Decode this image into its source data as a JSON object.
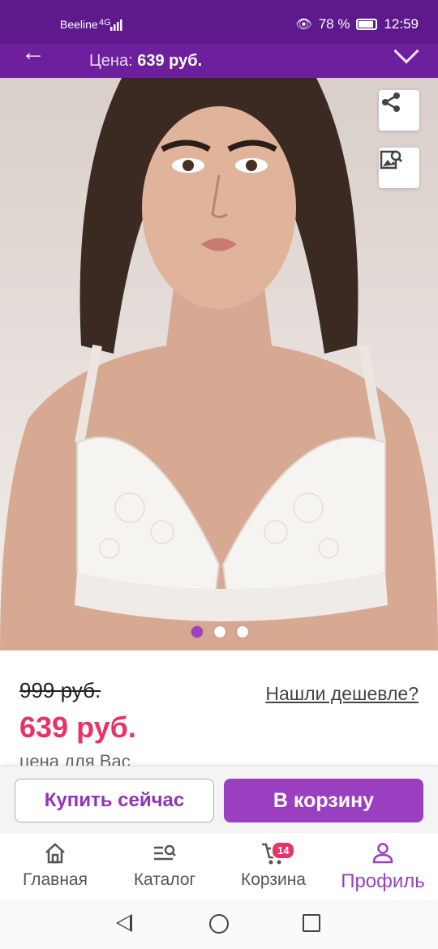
{
  "status_bar": {
    "carrier": "Beeline",
    "network": "4G",
    "battery": "78 %",
    "time": "12:59"
  },
  "header": {
    "price_label": "Цена:",
    "price_value": "639 руб."
  },
  "gallery": {
    "image_alt": "woman wearing white lace push-up bra",
    "dots": [
      true,
      false,
      false
    ]
  },
  "price": {
    "old": "999 руб.",
    "new": "639 руб.",
    "note": "цена для Вас",
    "cheaper_link": "Нашли дешевле?"
  },
  "actions": {
    "buy_now": "Купить сейчас",
    "add_to_cart": "В корзину"
  },
  "nav": {
    "items": [
      {
        "label": "Главная",
        "icon": "home-icon"
      },
      {
        "label": "Каталог",
        "icon": "catalog-search-icon"
      },
      {
        "label": "Корзина",
        "icon": "cart-icon",
        "badge": "14"
      },
      {
        "label": "Профиль",
        "icon": "profile-icon",
        "active": true
      }
    ]
  },
  "colors": {
    "brand_purple": "#9a3fc0",
    "price_pink": "#e8336a",
    "header_purple": "#6d1f9e"
  }
}
